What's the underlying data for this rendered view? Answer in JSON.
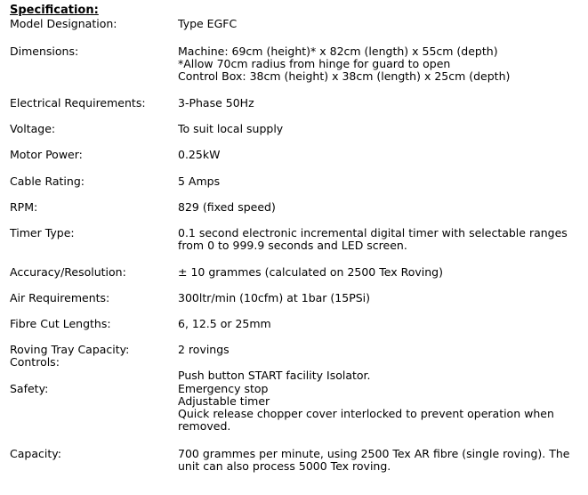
{
  "heading": "Specification:",
  "rows": [
    {
      "label": "Model Designation:",
      "value": [
        "Type EGFC"
      ]
    },
    {
      "label": "Dimensions:",
      "value": [
        "Machine: 69cm (height)* x 82cm (length) x 55cm (depth)",
        "*Allow 70cm radius from hinge for guard to open",
        "Control Box: 38cm (height) x 38cm (length) x 25cm (depth)"
      ]
    },
    {
      "label": "Electrical Requirements:",
      "value": [
        "3-Phase 50Hz"
      ]
    },
    {
      "label": "Voltage:",
      "value": [
        "To suit local supply"
      ]
    },
    {
      "label": "Motor Power:",
      "value": [
        "0.25kW"
      ]
    },
    {
      "label": "Cable Rating:",
      "value": [
        "5 Amps"
      ]
    },
    {
      "label": "RPM:",
      "value": [
        "829 (fixed speed)"
      ]
    },
    {
      "label": "Timer Type:",
      "value": [
        "0.1 second electronic incremental digital timer with selectable ranges",
        "from 0 to 999.9 seconds and LED screen."
      ]
    },
    {
      "label": "Accuracy/Resolution:",
      "value": [
        "± 10 grammes (calculated on 2500 Tex Roving)"
      ]
    },
    {
      "label": "Air Requirements:",
      "value": [
        "300ltr/min (10cfm) at 1bar (15PSi)"
      ]
    },
    {
      "label": "Fibre Cut Lengths:",
      "value": [
        "6, 12.5 or 25mm"
      ]
    },
    {
      "label": "Roving Tray Capacity:",
      "value": [
        "2 rovings"
      ]
    },
    {
      "label": "Controls:",
      "value": [
        "Push button START facility Isolator."
      ]
    },
    {
      "label": "Safety:",
      "value": [
        "Emergency stop",
        "Adjustable timer",
        "Quick release chopper cover interlocked to prevent operation when",
        "removed."
      ]
    },
    {
      "label": "Capacity:",
      "value": [
        "700 grammes per minute, using 2500 Tex AR fibre (single roving). The",
        "unit can also process 5000 Tex roving."
      ]
    }
  ]
}
